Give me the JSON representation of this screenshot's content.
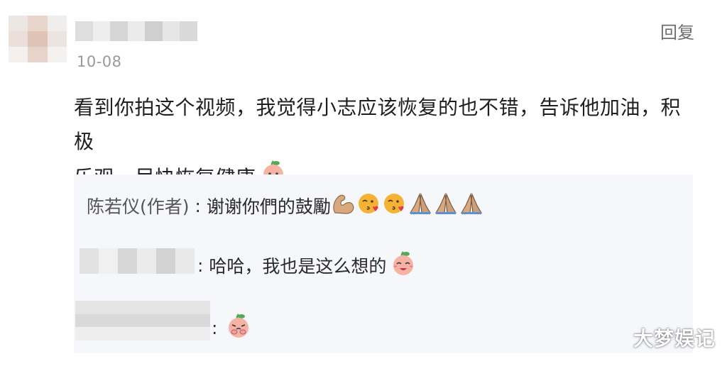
{
  "comment": {
    "timestamp": "10-08",
    "reply_label": "回复",
    "text_line1": "看到你拍这个视频，我觉得小志应该恢复的也不错，告诉他加油，积极",
    "text_line2": "乐观，尽快恢复健康",
    "emoji": "peach-blush-icon"
  },
  "replies": [
    {
      "author": "陈若仪(作者)",
      "separator": " : ",
      "text": "谢谢你們的鼓勵",
      "emojis": [
        "flexed-biceps-icon",
        "face-blowing-kiss-icon",
        "face-blowing-kiss-icon",
        "folded-hands-icon",
        "folded-hands-icon",
        "folded-hands-icon"
      ]
    },
    {
      "separator": ": ",
      "text": "哈哈，我也是这么想的",
      "emojis": [
        "peach-laugh-icon"
      ]
    },
    {
      "separator": ": ",
      "text": "",
      "emojis": [
        "peach-cry-icon"
      ]
    }
  ],
  "watermark": "大梦娱记",
  "colors": {
    "reply_box_bg": "#f5f7fb",
    "timestamp": "#9a9a9a",
    "reply_button": "#6e6e6e",
    "peach": "#f6b3a4",
    "leaf": "#57a854",
    "skin": "#d9a87c",
    "kiss_face": "#f5b335"
  }
}
